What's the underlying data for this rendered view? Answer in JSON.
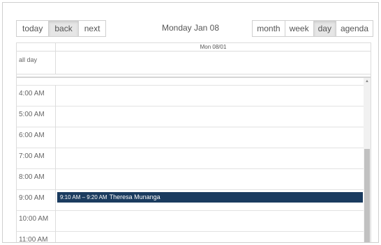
{
  "toolbar": {
    "nav": [
      "today",
      "back",
      "next"
    ],
    "nav_active": "back",
    "label": "Monday Jan 08",
    "views": [
      "month",
      "week",
      "day",
      "agenda"
    ],
    "view_active": "day"
  },
  "day_header": "Mon 08/01",
  "all_day_label": "all day",
  "time_slots": [
    "4:00 AM",
    "5:00 AM",
    "6:00 AM",
    "7:00 AM",
    "8:00 AM",
    "9:00 AM",
    "10:00 AM",
    "11:00 AM"
  ],
  "events": [
    {
      "time": "9:10 AM – 9:20 AM",
      "title": "Theresa Munanga",
      "start_hour": 9.1667,
      "color": "#1a3b5f"
    }
  ],
  "scroll_position": 0.45
}
